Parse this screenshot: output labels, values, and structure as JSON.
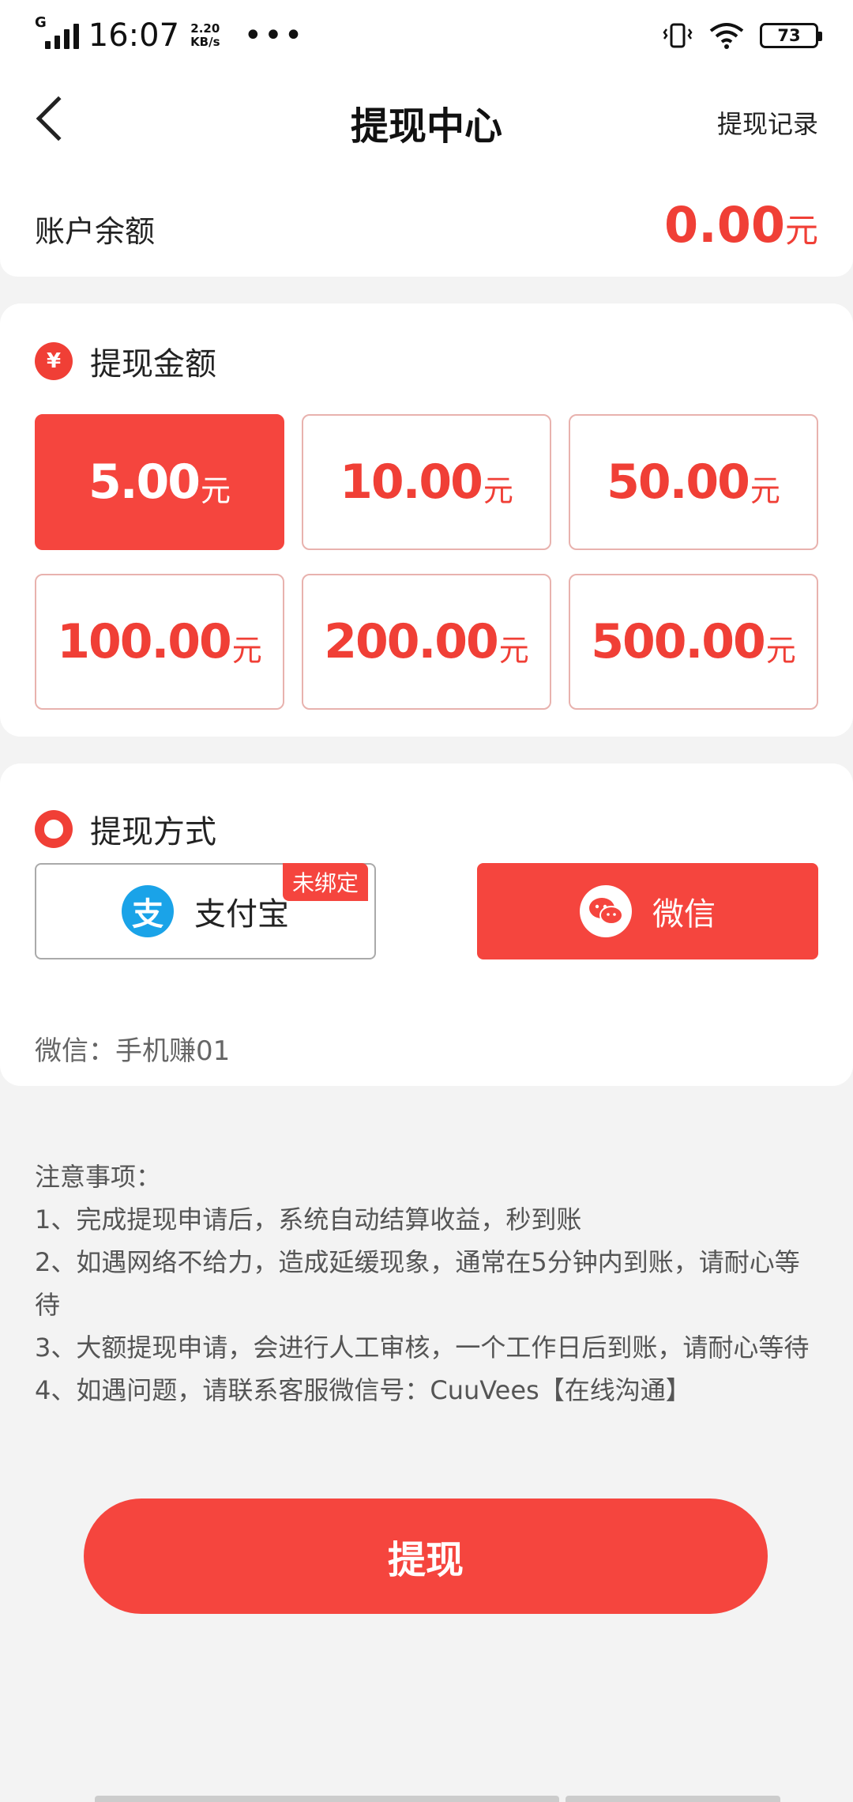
{
  "status_bar": {
    "time": "16:07",
    "network_type": "G",
    "speed_value": "2.20",
    "speed_unit": "KB/s",
    "more": "•••",
    "battery": "73"
  },
  "nav": {
    "title": "提现中心",
    "record_label": "提现记录"
  },
  "balance": {
    "label": "账户余额",
    "amount": "0.00",
    "unit": "元"
  },
  "amount_section": {
    "title": "提现金额",
    "icon_symbol": "¥",
    "options": [
      {
        "value": "5.00",
        "unit": "元",
        "selected": true
      },
      {
        "value": "10.00",
        "unit": "元",
        "selected": false
      },
      {
        "value": "50.00",
        "unit": "元",
        "selected": false
      },
      {
        "value": "100.00",
        "unit": "元",
        "selected": false
      },
      {
        "value": "200.00",
        "unit": "元",
        "selected": false
      },
      {
        "value": "500.00",
        "unit": "元",
        "selected": false
      }
    ]
  },
  "method_section": {
    "title": "提现方式",
    "alipay": {
      "label": "支付宝",
      "icon_char": "支",
      "badge": "未绑定"
    },
    "wechat": {
      "label": "微信",
      "selected": true
    },
    "account_text": "微信：手机赚01"
  },
  "notes": {
    "title": "注意事项：",
    "items": [
      "1、完成提现申请后，系统自动结算收益，秒到账",
      "2、如遇网络不给力，造成延缓现象，通常在5分钟内到账，请耐心等待",
      "3、大额提现申请，会进行人工审核，一个工作日后到账，请耐心等待",
      "4、如遇问题，请联系客服微信号：CuuVees【在线沟通】"
    ]
  },
  "submit_label": "提现",
  "colors": {
    "accent": "#f5453e",
    "accent_text": "#f03f36",
    "alipay_blue": "#1aa3e8"
  }
}
